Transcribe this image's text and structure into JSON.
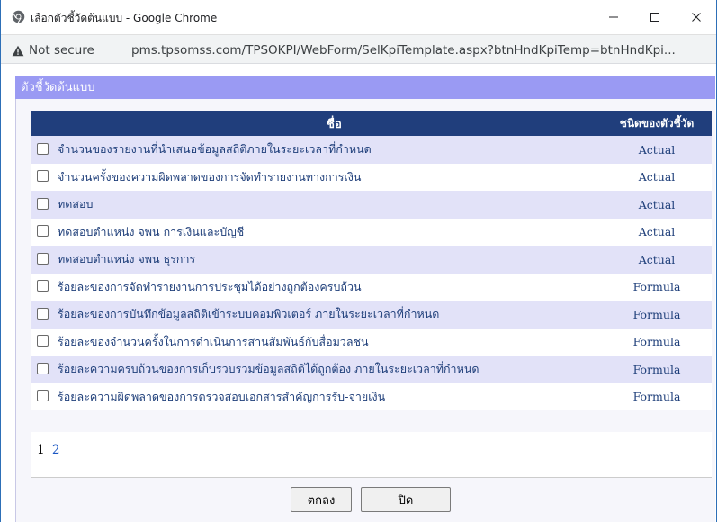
{
  "window": {
    "title": "เลือกตัวชี้วัดต้นแบบ - Google Chrome",
    "minimize_icon": "minimize-icon",
    "maximize_icon": "maximize-icon",
    "close_icon": "close-icon"
  },
  "address_bar": {
    "security_label": "Not secure",
    "url": "pms.tpsomss.com/TPSOKPI/WebForm/SelKpiTemplate.aspx?btnHndKpiTemp=btnHndKpi..."
  },
  "panel": {
    "title": "ตัวชี้วัดต้นแบบ"
  },
  "table": {
    "headers": {
      "name": "ชื่อ",
      "type": "ชนิดของตัวชี้วัด"
    },
    "rows": [
      {
        "name": "จำนวนของรายงานที่นำเสนอข้อมูลสถิติภายในระยะเวลาที่กำหนด",
        "type": "Actual"
      },
      {
        "name": "จำนวนครั้งของความผิดพลาดของการจัดทำรายงานทางการเงิน",
        "type": "Actual"
      },
      {
        "name": "ทดสอบ",
        "type": "Actual"
      },
      {
        "name": "ทดสอบตำแหน่ง จพน การเงินและบัญชี",
        "type": "Actual"
      },
      {
        "name": "ทดสอบตำแหน่ง จพน ธุรการ",
        "type": "Actual"
      },
      {
        "name": "ร้อยละของการจัดทำรายงานการประชุมได้อย่างถูกต้องครบถ้วน",
        "type": "Formula"
      },
      {
        "name": "ร้อยละของการบันทึกข้อมูลสถิติเข้าระบบคอมพิวเตอร์ ภายในระยะเวลาที่กำหนด",
        "type": "Formula"
      },
      {
        "name": "ร้อยละของจำนวนครั้งในการดำเนินการสานสัมพันธ์กับสื่อมวลชน",
        "type": "Formula"
      },
      {
        "name": "ร้อยละความครบถ้วนของการเก็บรวบรวมข้อมูลสถิติได้ถูกต้อง ภายในระยะเวลาที่กำหนด",
        "type": "Formula"
      },
      {
        "name": "ร้อยละความผิดพลาดของการตรวจสอบเอกสารสำคัญการรับ-จ่ายเงิน",
        "type": "Formula"
      }
    ]
  },
  "pager": {
    "current": "1",
    "pages": [
      "2"
    ]
  },
  "buttons": {
    "ok": "ตกลง",
    "close": "ปิด"
  },
  "colors": {
    "panel_header": "#9a9af3",
    "table_header": "#203e7c",
    "row_alt": "#e2e2f8",
    "link": "#1a56c2"
  }
}
